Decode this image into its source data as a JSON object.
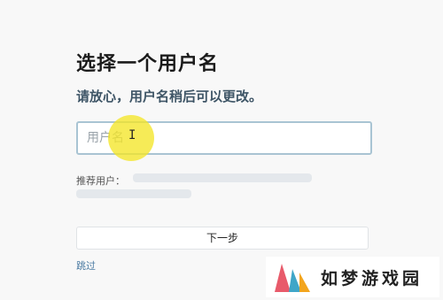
{
  "header": {
    "title": "选择一个用户名",
    "subtitle": "请放心，用户名稍后可以更改。"
  },
  "form": {
    "username_placeholder": "用户名",
    "username_value": "",
    "suggested_label": "推荐用户：",
    "next_button_label": "下一步",
    "skip_link_label": "跳过"
  },
  "cursor": {
    "glyph": "I",
    "highlight_color": "#f4e628"
  },
  "watermark": {
    "text": "如梦游戏园",
    "colors": [
      "#e85a6a",
      "#3fa6c8",
      "#f3a51e"
    ]
  }
}
